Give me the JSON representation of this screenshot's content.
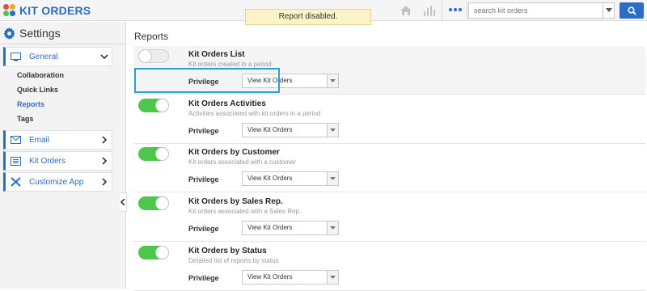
{
  "app": {
    "title": "KIT ORDERS"
  },
  "notice": "Report disabled.",
  "search": {
    "placeholder": "search kit orders"
  },
  "colors": {
    "accent": "#2b6cc4",
    "toggle_on": "#4cc74c",
    "highlight": "#2a9fd6",
    "notice_bg": "#fbf2c6"
  },
  "sidebar": {
    "title": "Settings",
    "general": {
      "label": "General",
      "icon": "monitor-icon",
      "expanded": true
    },
    "subitems": [
      {
        "label": "Collaboration",
        "active": false
      },
      {
        "label": "Quick Links",
        "active": false
      },
      {
        "label": "Reports",
        "active": true
      },
      {
        "label": "Tags",
        "active": false
      }
    ],
    "items": [
      {
        "label": "Email",
        "icon": "envelope-icon"
      },
      {
        "label": "Kit Orders",
        "icon": "list-icon"
      },
      {
        "label": "Customize App",
        "icon": "tools-icon"
      }
    ]
  },
  "main": {
    "title": "Reports",
    "privilege_label": "Privilege",
    "reports": [
      {
        "title": "Kit Orders List",
        "description": "Kit orders created in a period",
        "enabled": false,
        "privilege": "View Kit Orders"
      },
      {
        "title": "Kit Orders Activities",
        "description": "Activities associated with kit orders in a period",
        "enabled": true,
        "privilege": "View Kit Orders"
      },
      {
        "title": "Kit Orders by Customer",
        "description": "Kit orders associated with a customer",
        "enabled": true,
        "privilege": "View Kit Orders"
      },
      {
        "title": "Kit Orders by Sales Rep.",
        "description": "Kit orders associated with a Sales Rep.",
        "enabled": true,
        "privilege": "View Kit Orders"
      },
      {
        "title": "Kit Orders by Status",
        "description": "Detailed list of reports by status",
        "enabled": true,
        "privilege": "View Kit Orders"
      }
    ]
  }
}
